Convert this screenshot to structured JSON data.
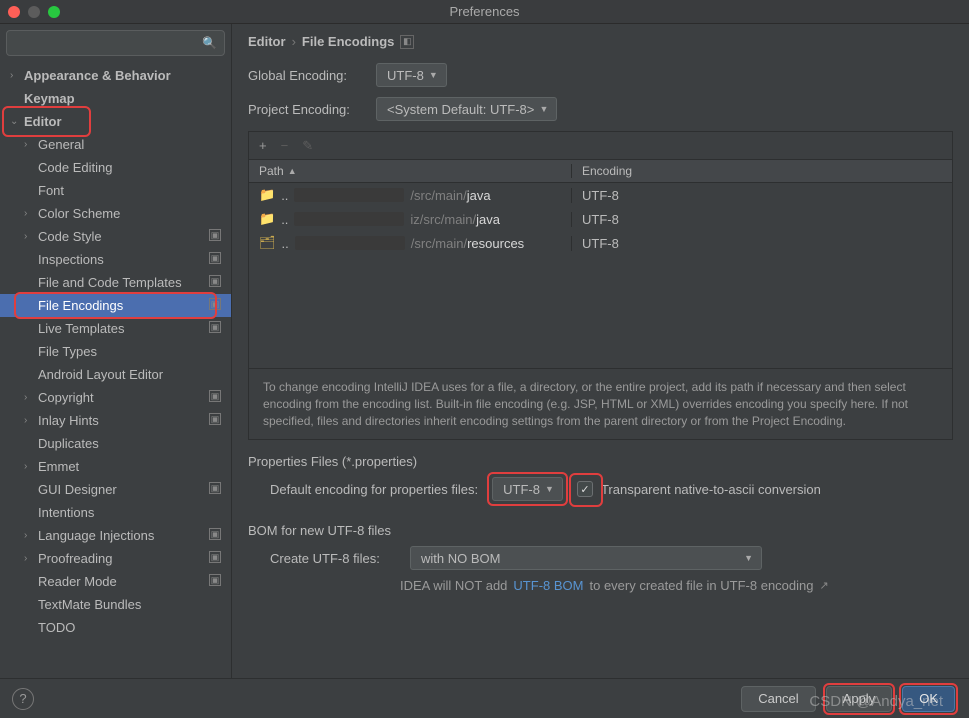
{
  "window": {
    "title": "Preferences"
  },
  "search": {
    "placeholder": ""
  },
  "sidebar": {
    "items": [
      {
        "label": "Appearance & Behavior",
        "level": 1,
        "arrow": "›",
        "name": "sidebar-item-appearance-behavior"
      },
      {
        "label": "Keymap",
        "level": 1,
        "arrow": "",
        "name": "sidebar-item-keymap"
      },
      {
        "label": "Editor",
        "level": 1,
        "arrow": "⌄",
        "name": "sidebar-item-editor",
        "highlight": true
      },
      {
        "label": "General",
        "level": 2,
        "arrow": "›",
        "name": "sidebar-item-general"
      },
      {
        "label": "Code Editing",
        "level": 2,
        "leaf": true,
        "name": "sidebar-item-code-editing"
      },
      {
        "label": "Font",
        "level": 2,
        "leaf": true,
        "name": "sidebar-item-font"
      },
      {
        "label": "Color Scheme",
        "level": 2,
        "arrow": "›",
        "name": "sidebar-item-color-scheme"
      },
      {
        "label": "Code Style",
        "level": 2,
        "arrow": "›",
        "gear": true,
        "name": "sidebar-item-code-style"
      },
      {
        "label": "Inspections",
        "level": 2,
        "leaf": true,
        "gear": true,
        "name": "sidebar-item-inspections"
      },
      {
        "label": "File and Code Templates",
        "level": 2,
        "leaf": true,
        "gear": true,
        "name": "sidebar-item-file-code-templates"
      },
      {
        "label": "File Encodings",
        "level": 2,
        "leaf": true,
        "gear": true,
        "selected": true,
        "highlight": true,
        "name": "sidebar-item-file-encodings"
      },
      {
        "label": "Live Templates",
        "level": 2,
        "leaf": true,
        "gear": true,
        "name": "sidebar-item-live-templates"
      },
      {
        "label": "File Types",
        "level": 2,
        "leaf": true,
        "name": "sidebar-item-file-types"
      },
      {
        "label": "Android Layout Editor",
        "level": 2,
        "leaf": true,
        "name": "sidebar-item-android-layout-editor"
      },
      {
        "label": "Copyright",
        "level": 2,
        "arrow": "›",
        "gear": true,
        "name": "sidebar-item-copyright"
      },
      {
        "label": "Inlay Hints",
        "level": 2,
        "arrow": "›",
        "gear": true,
        "name": "sidebar-item-inlay-hints"
      },
      {
        "label": "Duplicates",
        "level": 2,
        "leaf": true,
        "name": "sidebar-item-duplicates"
      },
      {
        "label": "Emmet",
        "level": 2,
        "arrow": "›",
        "name": "sidebar-item-emmet"
      },
      {
        "label": "GUI Designer",
        "level": 2,
        "leaf": true,
        "gear": true,
        "name": "sidebar-item-gui-designer"
      },
      {
        "label": "Intentions",
        "level": 2,
        "leaf": true,
        "name": "sidebar-item-intentions"
      },
      {
        "label": "Language Injections",
        "level": 2,
        "arrow": "›",
        "gear": true,
        "name": "sidebar-item-language-injections"
      },
      {
        "label": "Proofreading",
        "level": 2,
        "arrow": "›",
        "gear": true,
        "name": "sidebar-item-proofreading"
      },
      {
        "label": "Reader Mode",
        "level": 2,
        "leaf": true,
        "gear": true,
        "name": "sidebar-item-reader-mode"
      },
      {
        "label": "TextMate Bundles",
        "level": 2,
        "leaf": true,
        "name": "sidebar-item-textmate-bundles"
      },
      {
        "label": "TODO",
        "level": 2,
        "leaf": true,
        "name": "sidebar-item-todo"
      }
    ]
  },
  "breadcrumb": {
    "root": "Editor",
    "leaf": "File Encodings"
  },
  "globalEncoding": {
    "label": "Global Encoding:",
    "value": "UTF-8"
  },
  "projectEncoding": {
    "label": "Project Encoding:",
    "value": "<System Default: UTF-8>"
  },
  "toolbar": {
    "add": "+",
    "remove": "−",
    "edit": "✎"
  },
  "table": {
    "headers": {
      "path": "Path",
      "encoding": "Encoding",
      "sortArrow": "▲"
    },
    "rows": [
      {
        "icon": "folder",
        "prefix": "..",
        "dimPath": "/src/main/",
        "bright": "java",
        "encoding": "UTF-8"
      },
      {
        "icon": "folder",
        "prefix": "..",
        "dimPath": "iz/src/main/",
        "bright": "java",
        "encoding": "UTF-8"
      },
      {
        "icon": "resources",
        "prefix": "..",
        "dimPath": "/src/main/",
        "bright": "resources",
        "encoding": "UTF-8"
      }
    ]
  },
  "hint": "To change encoding IntelliJ IDEA uses for a file, a directory, or the entire project, add its path if necessary and then select encoding from the encoding list. Built-in file encoding (e.g. JSP, HTML or XML) overrides encoding you specify here. If not specified, files and directories inherit encoding settings from the parent directory or from the Project Encoding.",
  "props": {
    "section": "Properties Files (*.properties)",
    "label": "Default encoding for properties files:",
    "value": "UTF-8",
    "checkboxLabel": "Transparent native-to-ascii conversion",
    "checked": true
  },
  "bom": {
    "section": "BOM for new UTF-8 files",
    "label": "Create UTF-8 files:",
    "value": "with NO BOM",
    "note_pre": "IDEA will NOT add ",
    "note_link": "UTF-8 BOM",
    "note_post": " to every created file in UTF-8 encoding"
  },
  "footer": {
    "cancel": "Cancel",
    "apply": "Apply",
    "ok": "OK",
    "help": "?"
  },
  "watermark": "CSDN @Andya_net"
}
